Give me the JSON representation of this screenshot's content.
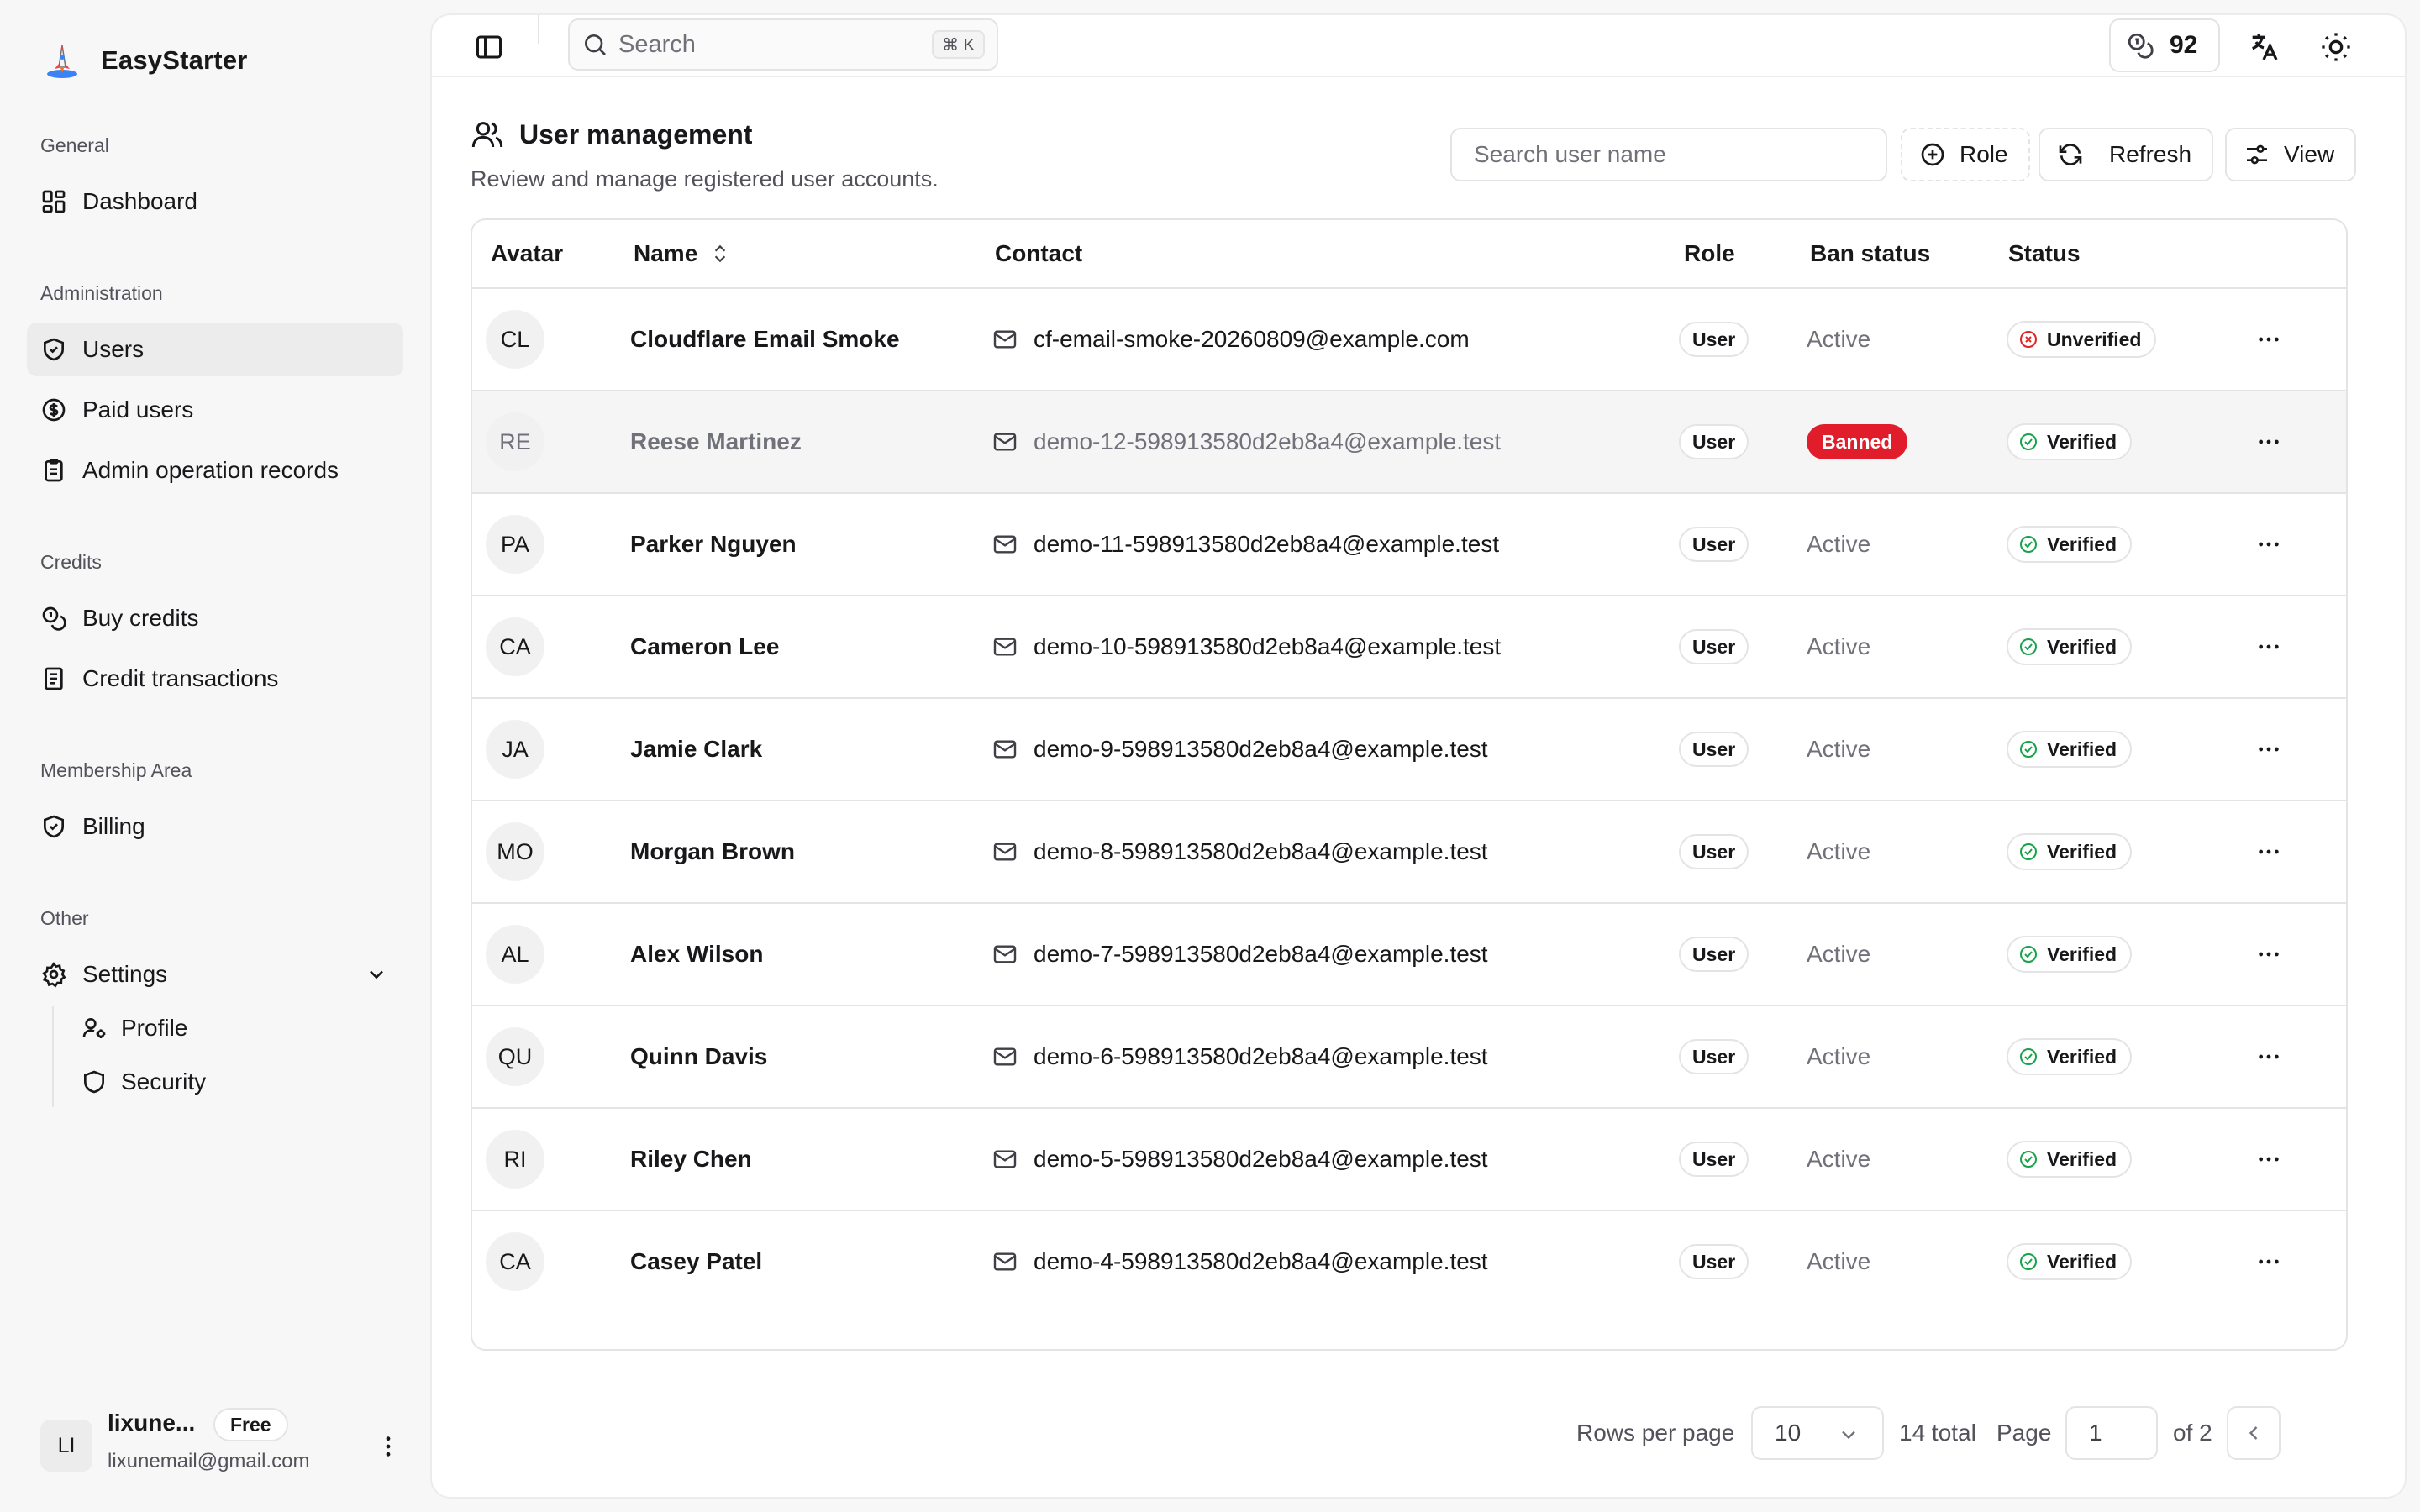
{
  "app": {
    "name": "EasyStarter"
  },
  "sidebar": {
    "groups": [
      {
        "label": "General",
        "items": [
          {
            "label": "Dashboard",
            "icon": "dashboard-icon"
          }
        ]
      },
      {
        "label": "Administration",
        "items": [
          {
            "label": "Users",
            "icon": "shield-check-icon",
            "active": true
          },
          {
            "label": "Paid users",
            "icon": "dollar-circle-icon"
          },
          {
            "label": "Admin operation records",
            "icon": "clipboard-icon"
          }
        ]
      },
      {
        "label": "Credits",
        "items": [
          {
            "label": "Buy credits",
            "icon": "coins-icon"
          },
          {
            "label": "Credit transactions",
            "icon": "receipt-icon"
          }
        ]
      },
      {
        "label": "Membership Area",
        "items": [
          {
            "label": "Billing",
            "icon": "shield-check-icon"
          }
        ]
      },
      {
        "label": "Other",
        "items": [
          {
            "label": "Settings",
            "icon": "gear-icon",
            "expanded": true
          }
        ]
      }
    ],
    "settings_sub": [
      {
        "label": "Profile",
        "icon": "user-cog-icon"
      },
      {
        "label": "Security",
        "icon": "shield-icon"
      }
    ],
    "user": {
      "initials": "LI",
      "name": "lixune...",
      "plan": "Free",
      "email": "lixunemail@gmail.com"
    }
  },
  "topbar": {
    "search_placeholder": "Search",
    "shortcut": "⌘ K",
    "credits": "92"
  },
  "page": {
    "title": "User management",
    "subtitle": "Review and manage registered user accounts.",
    "search_placeholder": "Search user name",
    "role_label": "Role",
    "refresh_label": "Refresh",
    "view_label": "View"
  },
  "table": {
    "columns": [
      "Avatar",
      "Name",
      "Contact",
      "Role",
      "Ban status",
      "Status"
    ],
    "rows": [
      {
        "initials": "CL",
        "name": "Cloudflare Email Smoke",
        "email": "cf-email-smoke-20260809@example.com",
        "role": "User",
        "ban": "Active",
        "status": "Unverified"
      },
      {
        "initials": "RE",
        "name": "Reese Martinez",
        "email": "demo-12-598913580d2eb8a4@example.test",
        "role": "User",
        "ban": "Banned",
        "status": "Verified"
      },
      {
        "initials": "PA",
        "name": "Parker Nguyen",
        "email": "demo-11-598913580d2eb8a4@example.test",
        "role": "User",
        "ban": "Active",
        "status": "Verified"
      },
      {
        "initials": "CA",
        "name": "Cameron Lee",
        "email": "demo-10-598913580d2eb8a4@example.test",
        "role": "User",
        "ban": "Active",
        "status": "Verified"
      },
      {
        "initials": "JA",
        "name": "Jamie Clark",
        "email": "demo-9-598913580d2eb8a4@example.test",
        "role": "User",
        "ban": "Active",
        "status": "Verified"
      },
      {
        "initials": "MO",
        "name": "Morgan Brown",
        "email": "demo-8-598913580d2eb8a4@example.test",
        "role": "User",
        "ban": "Active",
        "status": "Verified"
      },
      {
        "initials": "AL",
        "name": "Alex Wilson",
        "email": "demo-7-598913580d2eb8a4@example.test",
        "role": "User",
        "ban": "Active",
        "status": "Verified"
      },
      {
        "initials": "QU",
        "name": "Quinn Davis",
        "email": "demo-6-598913580d2eb8a4@example.test",
        "role": "User",
        "ban": "Active",
        "status": "Verified"
      },
      {
        "initials": "RI",
        "name": "Riley Chen",
        "email": "demo-5-598913580d2eb8a4@example.test",
        "role": "User",
        "ban": "Active",
        "status": "Verified"
      },
      {
        "initials": "CA",
        "name": "Casey Patel",
        "email": "demo-4-598913580d2eb8a4@example.test",
        "role": "User",
        "ban": "Active",
        "status": "Verified"
      }
    ]
  },
  "pagination": {
    "rows_per_page_label": "Rows per page",
    "rows_per_page": "10",
    "total": "14 total",
    "page_label": "Page",
    "page": "1",
    "of_pages": "of 2"
  },
  "colors": {
    "banned": "#e11d2b",
    "verified": "#16a34a",
    "unverified": "#dc2626",
    "active_nav_bg": "#ececec"
  }
}
